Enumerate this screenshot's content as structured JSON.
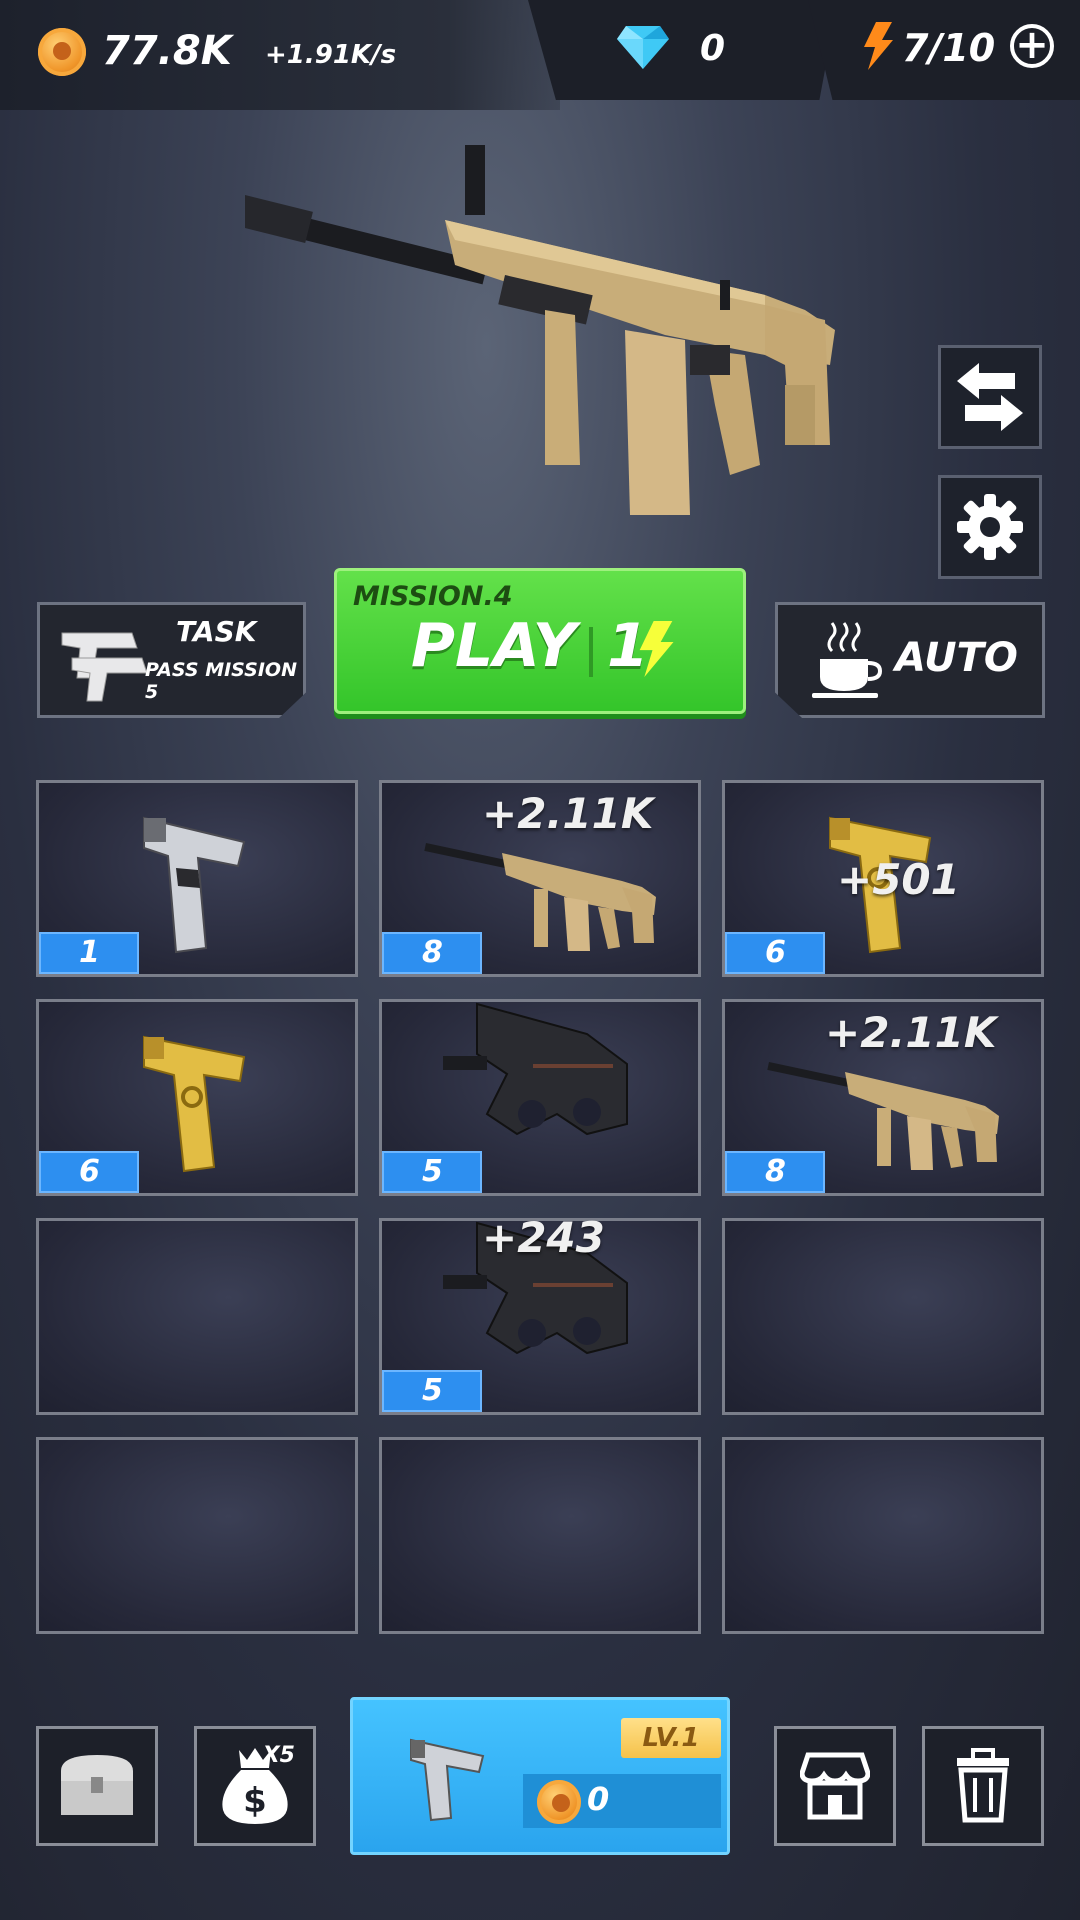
{
  "hud": {
    "coins": "77.8K",
    "income_rate": "+1.91K/s",
    "gems": "0",
    "energy": "7/10"
  },
  "actions": {
    "task_title": "TASK",
    "task_desc": "PASS MISSION 5",
    "mission_label": "MISSION.4",
    "play_label": "PLAY",
    "play_cost": "1",
    "auto_label": "AUTO"
  },
  "grid": [
    {
      "level": "1",
      "weapon": "silver-pistol",
      "bonus": ""
    },
    {
      "level": "8",
      "weapon": "tan-rifle",
      "bonus": "+2.11K"
    },
    {
      "level": "6",
      "weapon": "gold-pistol",
      "bonus": "+501"
    },
    {
      "level": "6",
      "weapon": "gold-pistol",
      "bonus": ""
    },
    {
      "level": "5",
      "weapon": "black-smg",
      "bonus": ""
    },
    {
      "level": "8",
      "weapon": "tan-rifle",
      "bonus": "+2.11K"
    },
    {
      "level": "",
      "weapon": "",
      "bonus": ""
    },
    {
      "level": "5",
      "weapon": "black-smg",
      "bonus": "+243"
    },
    {
      "level": "",
      "weapon": "",
      "bonus": ""
    },
    {
      "level": "",
      "weapon": "",
      "bonus": ""
    },
    {
      "level": "",
      "weapon": "",
      "bonus": ""
    },
    {
      "level": "",
      "weapon": "",
      "bonus": ""
    }
  ],
  "bottom": {
    "moneybag_multiplier": "X5",
    "buy_level": "LV.1",
    "buy_price": "0"
  },
  "colors": {
    "play_green": "#3fd12f",
    "buy_blue": "#2aa4ee",
    "level_blue": "#2d8ff0",
    "coin_orange": "#f0962a",
    "energy_orange": "#ff8a1a",
    "gem_cyan": "#3fc9f5"
  }
}
